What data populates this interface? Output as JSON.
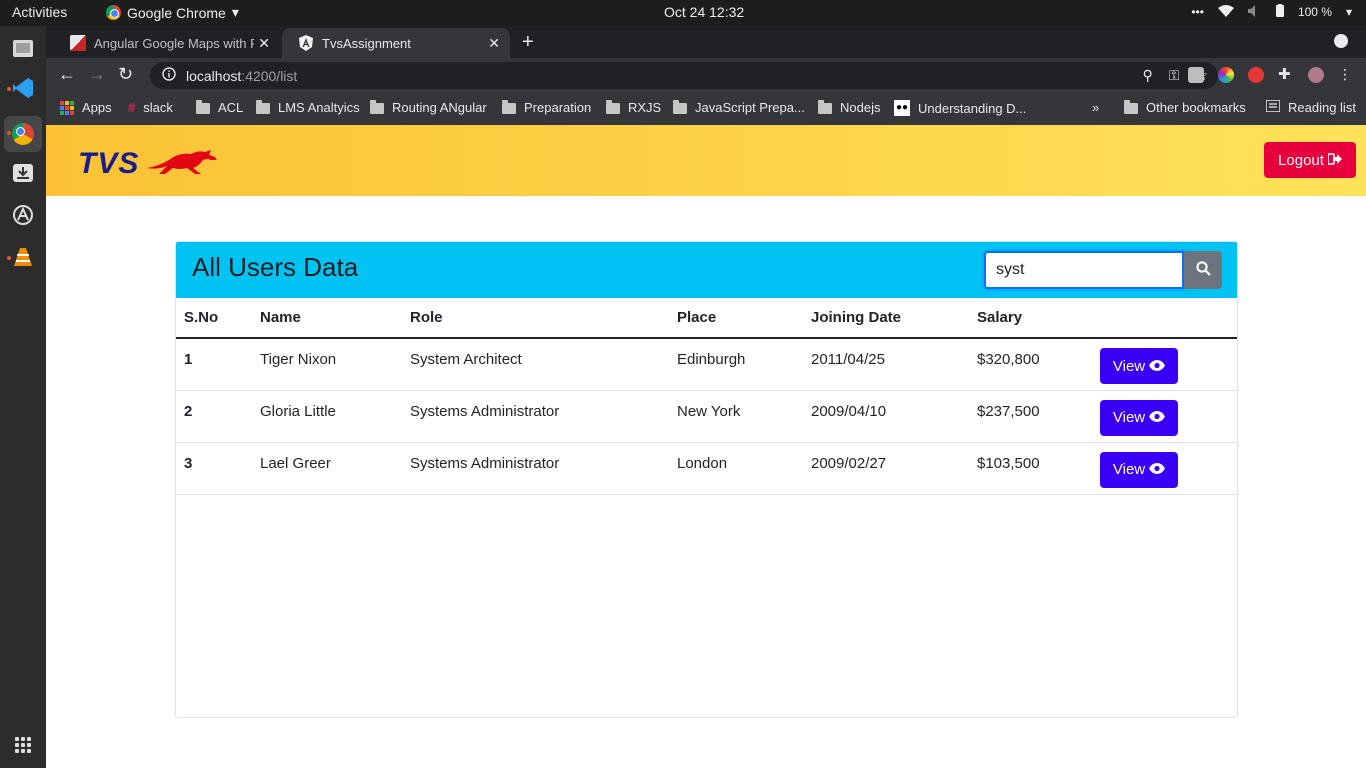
{
  "system": {
    "activities": "Activities",
    "app_name": "Google Chrome",
    "clock": "Oct 24  12:32",
    "battery": "100 %"
  },
  "browser": {
    "tabs": [
      {
        "title": "Angular Google Maps with Pla",
        "active": false
      },
      {
        "title": "TvsAssignment",
        "active": true
      }
    ],
    "url_host": "localhost",
    "url_path": ":4200/list",
    "bookmarks": [
      {
        "label": "Apps"
      },
      {
        "label": "slack"
      },
      {
        "label": "ACL"
      },
      {
        "label": "LMS Analtyics"
      },
      {
        "label": "Routing ANgular"
      },
      {
        "label": "Preparation"
      },
      {
        "label": "RXJS"
      },
      {
        "label": "JavaScript Prepa..."
      },
      {
        "label": "Nodejs"
      },
      {
        "label": "Understanding D..."
      }
    ],
    "overflow": "»",
    "other_bookmarks": "Other bookmarks",
    "reading_list": "Reading list"
  },
  "app": {
    "logo_text": "TVS",
    "logout_label": "Logout",
    "brand_colors": {
      "header_start": "#fbc235",
      "header_end": "#fee25a",
      "logout": "#e8003d",
      "card_header": "#00c3f3",
      "view_button": "#3a00f6"
    }
  },
  "card": {
    "title": "All Users Data",
    "search_value": "syst",
    "columns": [
      "S.No",
      "Name",
      "Role",
      "Place",
      "Joining Date",
      "Salary",
      ""
    ],
    "rows": [
      {
        "sno": "1",
        "name": "Tiger Nixon",
        "role": "System Architect",
        "place": "Edinburgh",
        "date": "2011/04/25",
        "salary": "$320,800",
        "action": "View"
      },
      {
        "sno": "2",
        "name": "Gloria Little",
        "role": "Systems Administrator",
        "place": "New York",
        "date": "2009/04/10",
        "salary": "$237,500",
        "action": "View"
      },
      {
        "sno": "3",
        "name": "Lael Greer",
        "role": "Systems Administrator",
        "place": "London",
        "date": "2009/02/27",
        "salary": "$103,500",
        "action": "View"
      }
    ]
  }
}
